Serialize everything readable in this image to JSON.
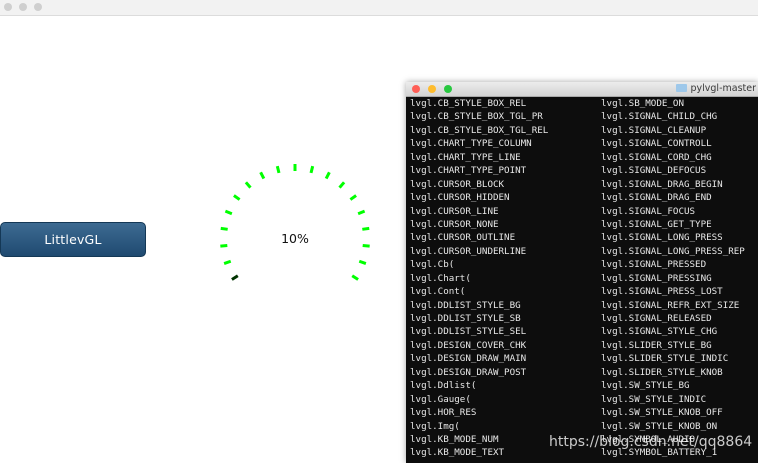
{
  "button": {
    "label": "LittlevGL"
  },
  "gauge": {
    "value_label": "10%",
    "value_fraction": 0.1,
    "active_color": "#00ff00",
    "indicator_color": "#003300"
  },
  "terminal": {
    "title": "pylvgl-master",
    "left_column": [
      "lvgl.CB_STYLE_BOX_REL",
      "lvgl.CB_STYLE_BOX_TGL_PR",
      "lvgl.CB_STYLE_BOX_TGL_REL",
      "lvgl.CHART_TYPE_COLUMN",
      "lvgl.CHART_TYPE_LINE",
      "lvgl.CHART_TYPE_POINT",
      "lvgl.CURSOR_BLOCK",
      "lvgl.CURSOR_HIDDEN",
      "lvgl.CURSOR_LINE",
      "lvgl.CURSOR_NONE",
      "lvgl.CURSOR_OUTLINE",
      "lvgl.CURSOR_UNDERLINE",
      "lvgl.Cb(",
      "lvgl.Chart(",
      "lvgl.Cont(",
      "lvgl.DDLIST_STYLE_BG",
      "lvgl.DDLIST_STYLE_SB",
      "lvgl.DDLIST_STYLE_SEL",
      "lvgl.DESIGN_COVER_CHK",
      "lvgl.DESIGN_DRAW_MAIN",
      "lvgl.DESIGN_DRAW_POST",
      "lvgl.Ddlist(",
      "lvgl.Gauge(",
      "lvgl.HOR_RES",
      "lvgl.Img(",
      "lvgl.KB_MODE_NUM",
      "lvgl.KB_MODE_TEXT"
    ],
    "right_column": [
      "lvgl.SB_MODE_ON",
      "lvgl.SIGNAL_CHILD_CHG",
      "lvgl.SIGNAL_CLEANUP",
      "lvgl.SIGNAL_CONTROLL",
      "lvgl.SIGNAL_CORD_CHG",
      "lvgl.SIGNAL_DEFOCUS",
      "lvgl.SIGNAL_DRAG_BEGIN",
      "lvgl.SIGNAL_DRAG_END",
      "lvgl.SIGNAL_FOCUS",
      "lvgl.SIGNAL_GET_TYPE",
      "lvgl.SIGNAL_LONG_PRESS",
      "lvgl.SIGNAL_LONG_PRESS_REP",
      "lvgl.SIGNAL_PRESSED",
      "lvgl.SIGNAL_PRESSING",
      "lvgl.SIGNAL_PRESS_LOST",
      "lvgl.SIGNAL_REFR_EXT_SIZE",
      "lvgl.SIGNAL_RELEASED",
      "lvgl.SIGNAL_STYLE_CHG",
      "lvgl.SLIDER_STYLE_BG",
      "lvgl.SLIDER_STYLE_INDIC",
      "lvgl.SLIDER_STYLE_KNOB",
      "lvgl.SW_STYLE_BG",
      "lvgl.SW_STYLE_INDIC",
      "lvgl.SW_STYLE_KNOB_OFF",
      "lvgl.SW_STYLE_KNOB_ON",
      "lvgl.SYMBOL_AUDIO",
      "lvgl.SYMBOL_BATTERY_1"
    ]
  },
  "watermark": "https://blog.csdn.net/qq8864"
}
